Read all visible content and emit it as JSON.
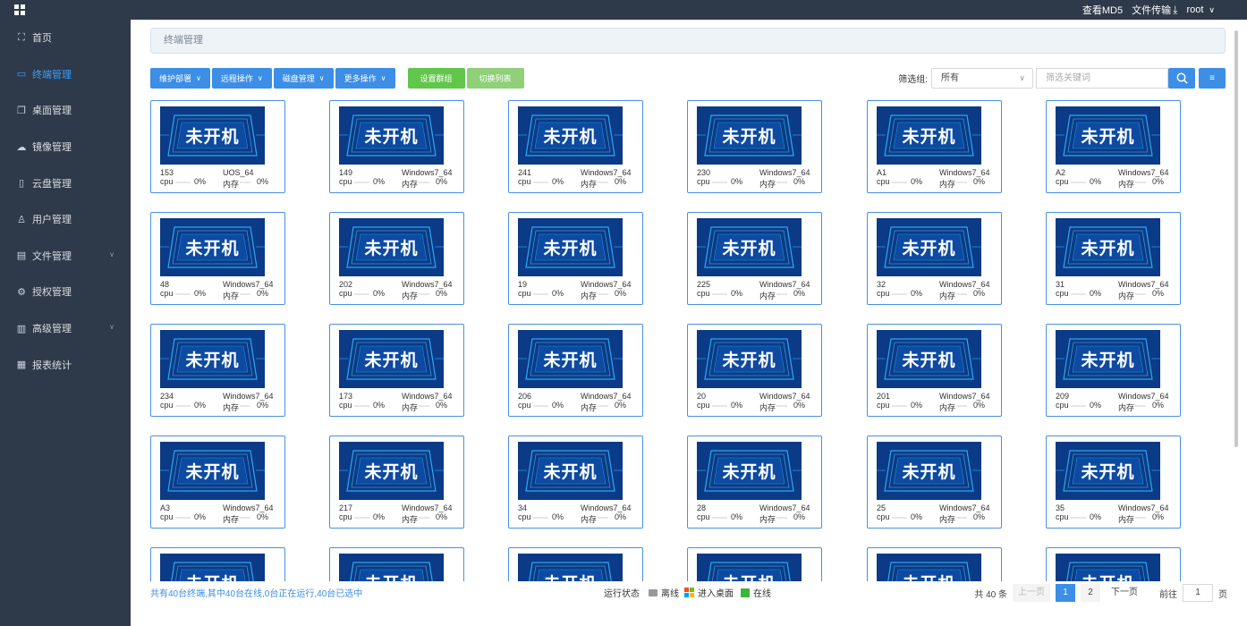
{
  "topbar": {
    "md5_label": "查看MD5",
    "transfer_label": "文件传输",
    "user": "root"
  },
  "sidebar": {
    "items": [
      {
        "label": "首页",
        "icon": "sitemap-icon"
      },
      {
        "label": "终端管理",
        "icon": "monitor-icon",
        "active": true
      },
      {
        "label": "桌面管理",
        "icon": "copy-icon"
      },
      {
        "label": "镜像管理",
        "icon": "cloud-icon"
      },
      {
        "label": "云盘管理",
        "icon": "disk-icon"
      },
      {
        "label": "用户管理",
        "icon": "user-icon"
      },
      {
        "label": "文件管理",
        "icon": "briefcase-icon",
        "expandable": true
      },
      {
        "label": "授权管理",
        "icon": "gear-icon"
      },
      {
        "label": "高级管理",
        "icon": "document-icon",
        "expandable": true
      },
      {
        "label": "报表统计",
        "icon": "report-icon"
      }
    ]
  },
  "breadcrumb": "终端管理",
  "toolbar": {
    "dropdowns": [
      "维护部署",
      "远程操作",
      "磁盘管理",
      "更多操作"
    ],
    "set_group": "设置群组",
    "switch_list": "切换列表"
  },
  "filter": {
    "label": "筛选组:",
    "group_value": "所有",
    "keyword_placeholder": "筛选关键词"
  },
  "card_status": "未开机",
  "card_labels": {
    "cpu": "cpu",
    "mem": "内存"
  },
  "terminals": [
    {
      "name": "153",
      "os": "UOS_64",
      "cpu": "0%",
      "mem": "0%"
    },
    {
      "name": "149",
      "os": "Windows7_64",
      "cpu": "0%",
      "mem": "0%"
    },
    {
      "name": "241",
      "os": "Windows7_64",
      "cpu": "0%",
      "mem": "0%"
    },
    {
      "name": "230",
      "os": "Windows7_64",
      "cpu": "0%",
      "mem": "0%"
    },
    {
      "name": "A1",
      "os": "Windows7_64",
      "cpu": "0%",
      "mem": "0%"
    },
    {
      "name": "A2",
      "os": "Windows7_64",
      "cpu": "0%",
      "mem": "0%"
    },
    {
      "name": "48",
      "os": "Windows7_64",
      "cpu": "0%",
      "mem": "0%"
    },
    {
      "name": "202",
      "os": "Windows7_64",
      "cpu": "0%",
      "mem": "0%"
    },
    {
      "name": "19",
      "os": "Windows7_64",
      "cpu": "0%",
      "mem": "0%"
    },
    {
      "name": "225",
      "os": "Windows7_64",
      "cpu": "0%",
      "mem": "0%"
    },
    {
      "name": "32",
      "os": "Windows7_64",
      "cpu": "0%",
      "mem": "0%"
    },
    {
      "name": "31",
      "os": "Windows7_64",
      "cpu": "0%",
      "mem": "0%"
    },
    {
      "name": "234",
      "os": "Windows7_64",
      "cpu": "0%",
      "mem": "0%"
    },
    {
      "name": "173",
      "os": "Windows7_64",
      "cpu": "0%",
      "mem": "0%"
    },
    {
      "name": "206",
      "os": "Windows7_64",
      "cpu": "0%",
      "mem": "0%"
    },
    {
      "name": "20",
      "os": "Windows7_64",
      "cpu": "0%",
      "mem": "0%"
    },
    {
      "name": "201",
      "os": "Windows7_64",
      "cpu": "0%",
      "mem": "0%"
    },
    {
      "name": "209",
      "os": "Windows7_64",
      "cpu": "0%",
      "mem": "0%"
    },
    {
      "name": "A3",
      "os": "Windows7_64",
      "cpu": "0%",
      "mem": "0%"
    },
    {
      "name": "217",
      "os": "Windows7_64",
      "cpu": "0%",
      "mem": "0%"
    },
    {
      "name": "34",
      "os": "Windows7_64",
      "cpu": "0%",
      "mem": "0%"
    },
    {
      "name": "28",
      "os": "Windows7_64",
      "cpu": "0%",
      "mem": "0%"
    },
    {
      "name": "25",
      "os": "Windows7_64",
      "cpu": "0%",
      "mem": "0%"
    },
    {
      "name": "35",
      "os": "Windows7_64",
      "cpu": "0%",
      "mem": "0%"
    },
    {
      "name": "",
      "os": "",
      "cpu": "",
      "mem": ""
    },
    {
      "name": "",
      "os": "",
      "cpu": "",
      "mem": ""
    },
    {
      "name": "",
      "os": "",
      "cpu": "",
      "mem": ""
    },
    {
      "name": "",
      "os": "",
      "cpu": "",
      "mem": ""
    },
    {
      "name": "",
      "os": "",
      "cpu": "",
      "mem": ""
    },
    {
      "name": "",
      "os": "",
      "cpu": "",
      "mem": ""
    }
  ],
  "footer": {
    "summary": "共有40台终端,其中40台在线,0台正在运行,40台已选中",
    "legend_title": "运行状态",
    "legend_offline": "离线",
    "legend_desktop": "进入桌面",
    "legend_online": "在线",
    "total": "共 40 条",
    "prev": "上一页",
    "pages": [
      "1",
      "2"
    ],
    "next": "下一页",
    "goto_label": "前往",
    "goto_value": "1",
    "page_suffix": "页"
  },
  "colors": {
    "sidebar_bg": "#2e3a4a",
    "accent": "#3c8ee6",
    "green": "#62c64b",
    "card_border": "#4a90e2",
    "thumb_bg": "#0b3a86"
  }
}
